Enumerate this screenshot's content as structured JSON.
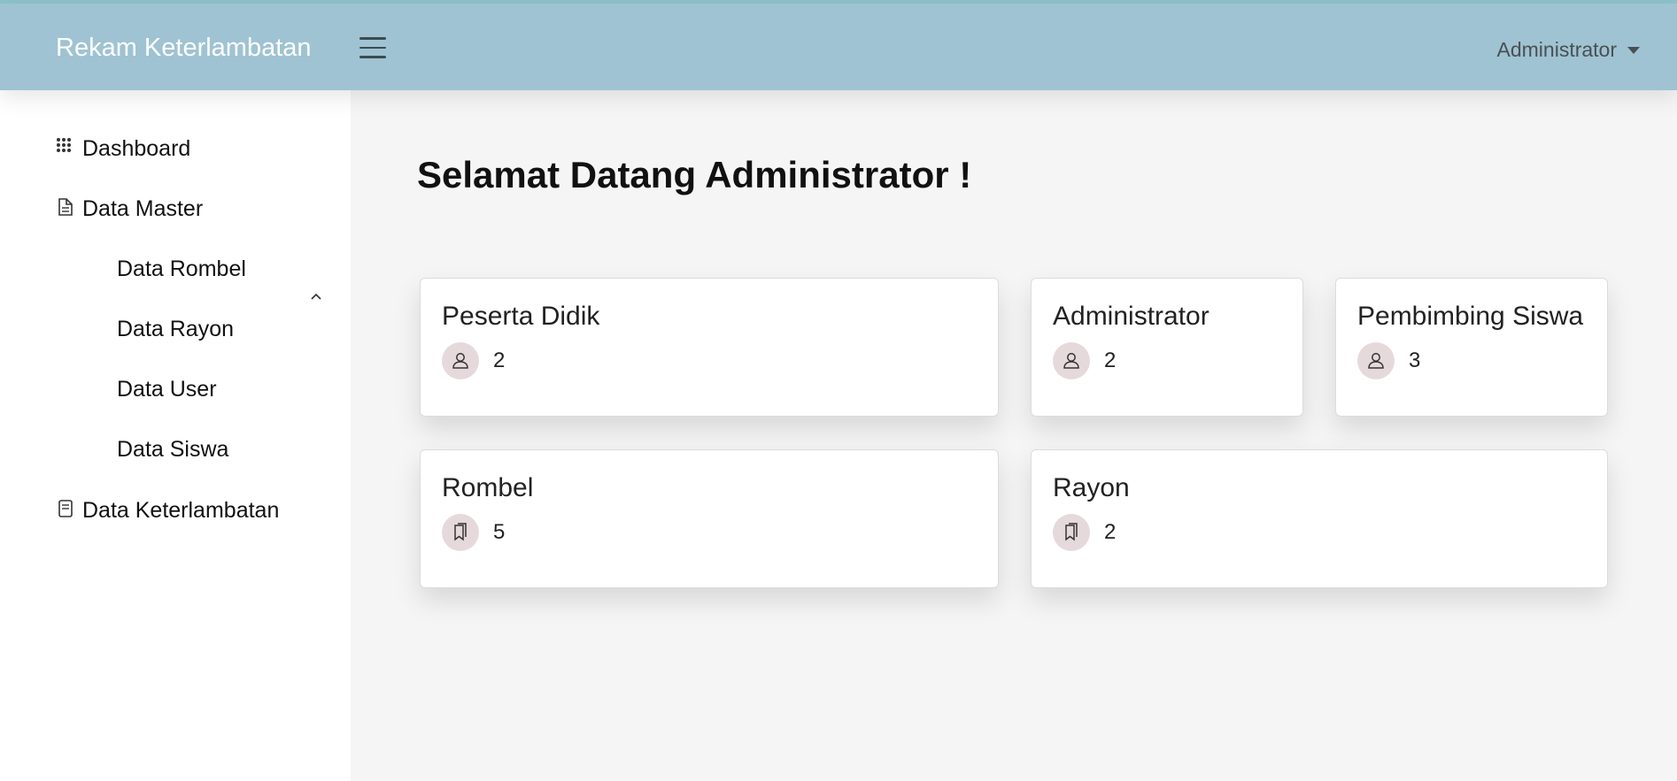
{
  "header": {
    "brand": "Rekam Keterlambatan",
    "user_menu_label": "Administrator"
  },
  "sidebar": {
    "items": [
      {
        "label": "Dashboard",
        "icon": "grid-icon"
      },
      {
        "label": "Data Master",
        "icon": "file-text-icon",
        "expanded": true,
        "children": [
          {
            "label": "Data Rombel"
          },
          {
            "label": "Data Rayon"
          },
          {
            "label": "Data User"
          },
          {
            "label": "Data Siswa"
          }
        ]
      },
      {
        "label": "Data Keterlambatan",
        "icon": "document-icon"
      }
    ]
  },
  "main": {
    "title": "Selamat Datang Administrator !",
    "cards": [
      {
        "title": "Peserta Didik",
        "icon": "person-icon",
        "value": "2"
      },
      {
        "title": "Administrator",
        "icon": "person-icon",
        "value": "2"
      },
      {
        "title": "Pembimbing Siswa",
        "icon": "person-icon",
        "value": "3"
      },
      {
        "title": "Rombel",
        "icon": "bookmarks-icon",
        "value": "5"
      },
      {
        "title": "Rayon",
        "icon": "bookmarks-icon",
        "value": "2"
      }
    ]
  },
  "colors": {
    "navbar": "#9fc3d2",
    "icon_badge": "#e6d9dc",
    "page_background": "#f5f5f5"
  }
}
